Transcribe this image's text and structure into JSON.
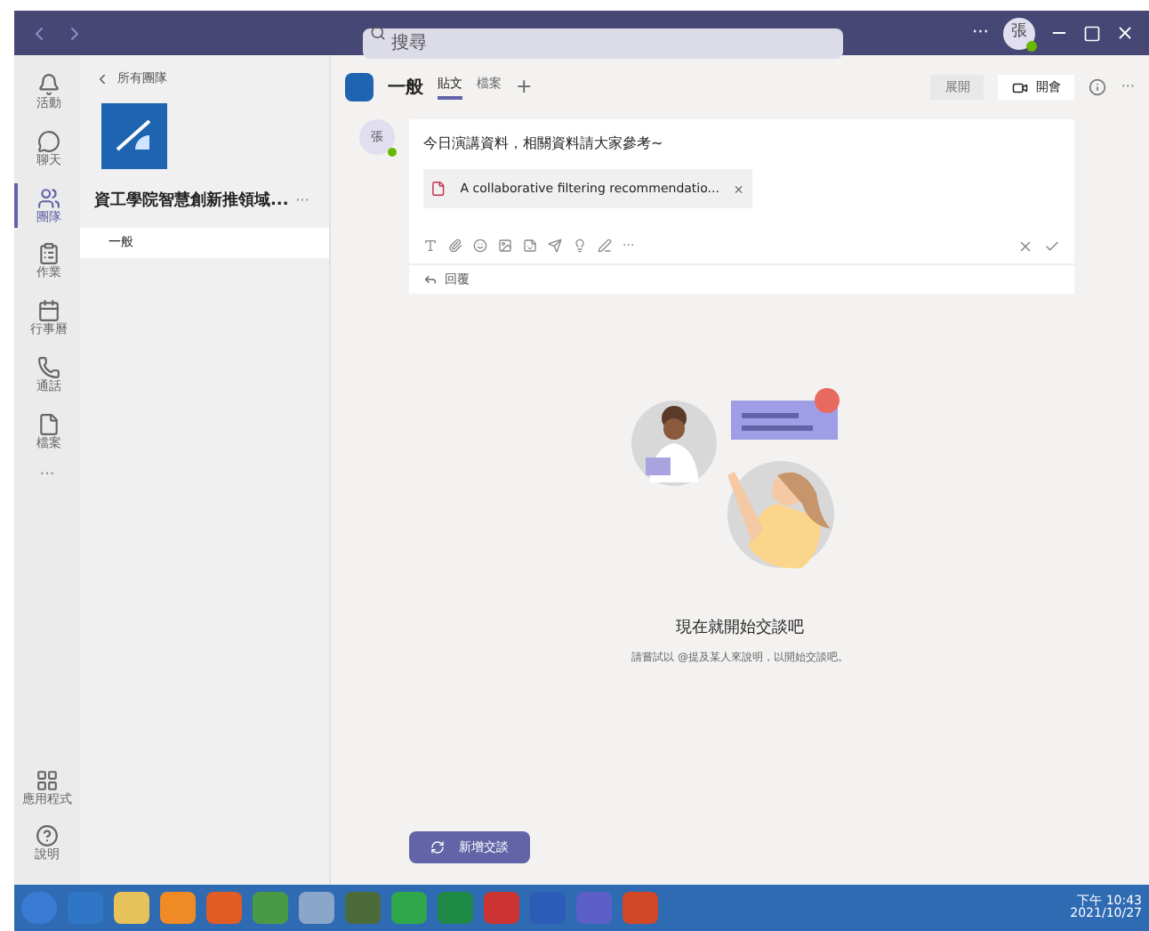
{
  "titlebar": {
    "search": {
      "placeholder": "搜尋"
    },
    "more": "···",
    "avatar": "張",
    "online": true
  },
  "rail": {
    "items": [
      {
        "label": "活動",
        "selected": false
      },
      {
        "label": "聊天",
        "selected": false
      },
      {
        "label": "團隊",
        "selected": true
      },
      {
        "label": "作業",
        "selected": false
      },
      {
        "label": "行事曆",
        "selected": false
      },
      {
        "label": "通話",
        "selected": false
      },
      {
        "label": "檔案",
        "selected": false
      }
    ],
    "more": "···",
    "bottom": [
      {
        "label": "應用程式"
      },
      {
        "label": "說明"
      }
    ]
  },
  "team": {
    "back": "所有團隊",
    "name": "資工學院智慧創新推領域...",
    "more": "···",
    "channels": [
      {
        "label": "一般",
        "selected": true
      }
    ]
  },
  "channel": {
    "name": "一般",
    "tabs": [
      {
        "label": "貼文",
        "selected": true
      },
      {
        "label": "檔案",
        "selected": false
      }
    ],
    "add": "+",
    "expand": "展開",
    "meet": "開會",
    "more": "···"
  },
  "post": {
    "avatar": "張",
    "online": true,
    "text": "今日演講資料，相關資料請大家參考~",
    "attachment": "A collaborative filtering recommendatio...",
    "more": "···",
    "reply": "回覆"
  },
  "empty": {
    "title": "現在就開始交談吧",
    "subtitle": "請嘗試以 @提及某人來說明，以開始交談吧。"
  },
  "new_button": "新增交談",
  "taskbar": {
    "time": "下午 10:43",
    "date": "2021/10/27"
  }
}
